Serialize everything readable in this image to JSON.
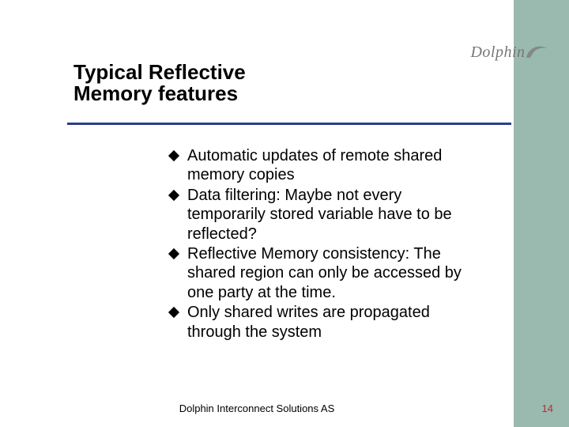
{
  "brand": {
    "name": "Dolphin"
  },
  "title": "Typical Reflective Memory features",
  "bullets": [
    "Automatic updates of remote shared memory copies",
    "Data filtering: Maybe not every temporarily stored variable have to be reflected?",
    "Reflective Memory consistency: The shared region can only be accessed by one party at the time.",
    "Only shared writes are propagated through the system"
  ],
  "footer": "Dolphin Interconnect Solutions AS",
  "page_number": "14",
  "colors": {
    "sidebar": "#9ab9af",
    "divider": "#2a3e8c",
    "pagenum": "#b03030"
  }
}
